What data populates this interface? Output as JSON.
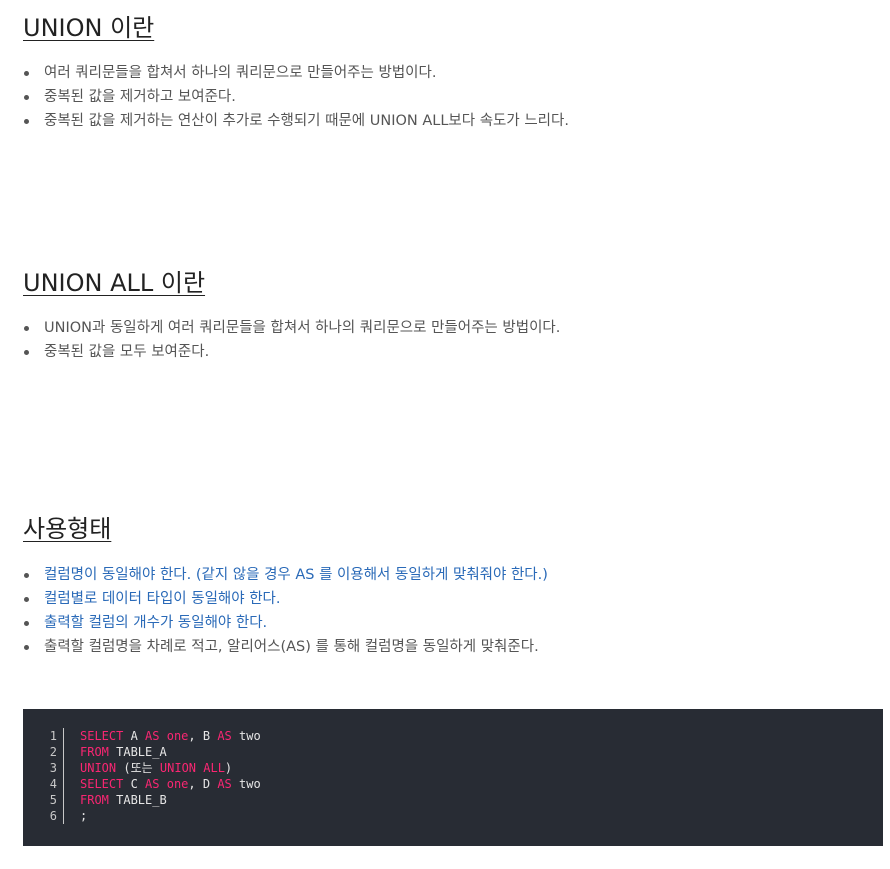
{
  "sections": [
    {
      "title": "UNION 이란",
      "bullets": [
        {
          "text": "여러 쿼리문들을 합쳐서 하나의 쿼리문으로 만들어주는 방법이다.",
          "style": "normal"
        },
        {
          "text": "중복된 값을 제거하고 보여준다.",
          "style": "normal"
        },
        {
          "text": "중복된 값을 제거하는 연산이 추가로 수행되기 때문에 UNION ALL보다 속도가 느리다.",
          "style": "normal"
        }
      ]
    },
    {
      "title": "UNION ALL 이란",
      "bullets": [
        {
          "text": "UNION과 동일하게 여러 쿼리문들을 합쳐서 하나의 쿼리문으로 만들어주는 방법이다.",
          "style": "normal"
        },
        {
          "text": "중복된 값을 모두 보여준다.",
          "style": "normal"
        }
      ]
    },
    {
      "title": "사용형태",
      "bullets": [
        {
          "text": "컬럼명이 동일해야 한다. (같지 않을 경우 AS 를 이용해서 동일하게 맞춰줘야 한다.)",
          "style": "blue"
        },
        {
          "text": "컬럼별로 데이터 타입이 동일해야 한다.",
          "style": "blue"
        },
        {
          "text": "출력할 컬럼의 개수가 동일해야 한다.",
          "style": "blue"
        },
        {
          "text": "출력할 컬럼명을 차례로 적고, 알리어스(AS) 를 통해 컬럼명을 동일하게 맞춰준다.",
          "style": "normal"
        }
      ]
    }
  ],
  "code": {
    "lines": [
      {
        "num": "1",
        "tokens": [
          {
            "t": "SELECT",
            "k": true
          },
          {
            "t": " A ",
            "k": false
          },
          {
            "t": "AS",
            "k": true
          },
          {
            "t": " ",
            "k": false
          },
          {
            "t": "one",
            "k": true
          },
          {
            "t": ", B ",
            "k": false
          },
          {
            "t": "AS",
            "k": true
          },
          {
            "t": " two",
            "k": false
          }
        ]
      },
      {
        "num": "2",
        "tokens": [
          {
            "t": "FROM",
            "k": true
          },
          {
            "t": " TABLE_A",
            "k": false
          }
        ]
      },
      {
        "num": "3",
        "tokens": [
          {
            "t": "UNION",
            "k": true
          },
          {
            "t": " (또는 ",
            "k": false
          },
          {
            "t": "UNION ALL",
            "k": true
          },
          {
            "t": ")",
            "k": false
          }
        ]
      },
      {
        "num": "4",
        "tokens": [
          {
            "t": "SELECT",
            "k": true
          },
          {
            "t": " C ",
            "k": false
          },
          {
            "t": "AS",
            "k": true
          },
          {
            "t": " ",
            "k": false
          },
          {
            "t": "one",
            "k": true
          },
          {
            "t": ", D ",
            "k": false
          },
          {
            "t": "AS",
            "k": true
          },
          {
            "t": " two",
            "k": false
          }
        ]
      },
      {
        "num": "5",
        "tokens": [
          {
            "t": "FROM",
            "k": true
          },
          {
            "t": " TABLE_B",
            "k": false
          }
        ]
      },
      {
        "num": "6",
        "tokens": [
          {
            "t": ";",
            "k": false
          }
        ]
      }
    ]
  },
  "colors": {
    "text": "#555555",
    "heading": "#222222",
    "link_blue": "#2a6ab8",
    "code_bg": "#282c34",
    "code_keyword": "#f92672",
    "code_text": "#e6e6e6"
  }
}
